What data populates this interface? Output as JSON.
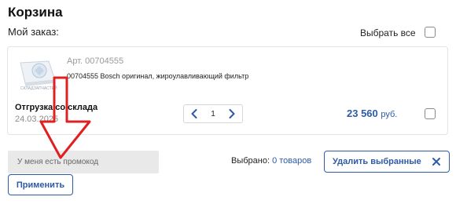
{
  "page": {
    "title": "Корзина",
    "my_order_label": "Мой заказ:",
    "select_all_label": "Выбрать все"
  },
  "item": {
    "article": "Арт. 00704555",
    "description": "00704555 Bosch оригинал, жироулавливающий фильтр",
    "thumbnail_caption": "СКЛАДЗАПЧАСТЕЙ",
    "shipping_label": "Отгрузка со склада",
    "shipping_date": "24.03.2025",
    "quantity": "1",
    "price_value": "23 560",
    "price_currency": "руб."
  },
  "promo": {
    "placeholder": "У меня есть промокод",
    "apply_label": "Применить"
  },
  "selection": {
    "label": "Выбрано:",
    "count_text": "0 товаров",
    "delete_label": "Удалить выбранные"
  },
  "colors": {
    "accent": "#2e5aa8",
    "annotation_arrow": "#e02020"
  },
  "icons": {
    "decrease": "chevron-left-icon",
    "increase": "chevron-right-icon",
    "delete": "close-icon",
    "annotation": "arrow-down-annotation"
  }
}
